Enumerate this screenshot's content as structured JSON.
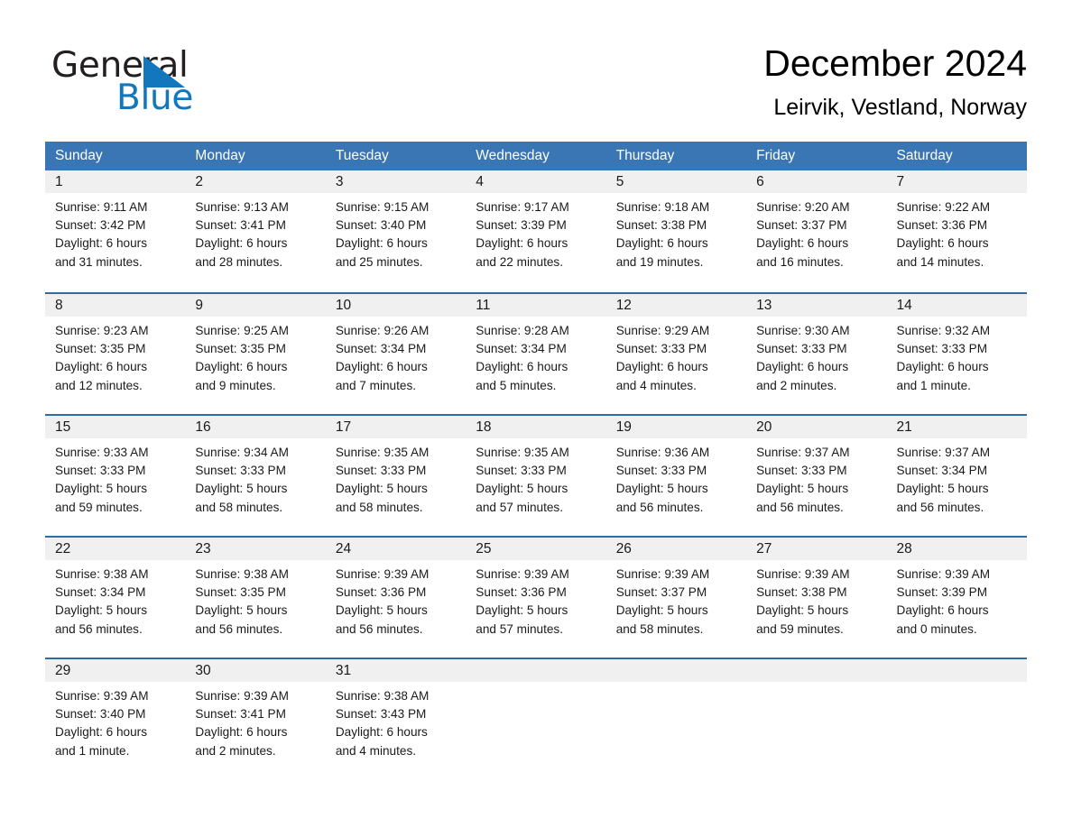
{
  "brand": {
    "name_part1": "General",
    "name_part2": "Blue",
    "triangle_color": "#1277bc",
    "text_color": "#231f20"
  },
  "header": {
    "month_title": "December 2024",
    "location": "Leirvik, Vestland, Norway"
  },
  "calendar": {
    "header_bg": "#3a76b4",
    "row_divider": "#2e6da4",
    "date_band_bg": "#f0f0f0",
    "weekdays": [
      "Sunday",
      "Monday",
      "Tuesday",
      "Wednesday",
      "Thursday",
      "Friday",
      "Saturday"
    ],
    "weeks": [
      [
        {
          "day": "1",
          "sunrise": "Sunrise: 9:11 AM",
          "sunset": "Sunset: 3:42 PM",
          "daylight_line1": "Daylight: 6 hours",
          "daylight_line2": "and 31 minutes."
        },
        {
          "day": "2",
          "sunrise": "Sunrise: 9:13 AM",
          "sunset": "Sunset: 3:41 PM",
          "daylight_line1": "Daylight: 6 hours",
          "daylight_line2": "and 28 minutes."
        },
        {
          "day": "3",
          "sunrise": "Sunrise: 9:15 AM",
          "sunset": "Sunset: 3:40 PM",
          "daylight_line1": "Daylight: 6 hours",
          "daylight_line2": "and 25 minutes."
        },
        {
          "day": "4",
          "sunrise": "Sunrise: 9:17 AM",
          "sunset": "Sunset: 3:39 PM",
          "daylight_line1": "Daylight: 6 hours",
          "daylight_line2": "and 22 minutes."
        },
        {
          "day": "5",
          "sunrise": "Sunrise: 9:18 AM",
          "sunset": "Sunset: 3:38 PM",
          "daylight_line1": "Daylight: 6 hours",
          "daylight_line2": "and 19 minutes."
        },
        {
          "day": "6",
          "sunrise": "Sunrise: 9:20 AM",
          "sunset": "Sunset: 3:37 PM",
          "daylight_line1": "Daylight: 6 hours",
          "daylight_line2": "and 16 minutes."
        },
        {
          "day": "7",
          "sunrise": "Sunrise: 9:22 AM",
          "sunset": "Sunset: 3:36 PM",
          "daylight_line1": "Daylight: 6 hours",
          "daylight_line2": "and 14 minutes."
        }
      ],
      [
        {
          "day": "8",
          "sunrise": "Sunrise: 9:23 AM",
          "sunset": "Sunset: 3:35 PM",
          "daylight_line1": "Daylight: 6 hours",
          "daylight_line2": "and 12 minutes."
        },
        {
          "day": "9",
          "sunrise": "Sunrise: 9:25 AM",
          "sunset": "Sunset: 3:35 PM",
          "daylight_line1": "Daylight: 6 hours",
          "daylight_line2": "and 9 minutes."
        },
        {
          "day": "10",
          "sunrise": "Sunrise: 9:26 AM",
          "sunset": "Sunset: 3:34 PM",
          "daylight_line1": "Daylight: 6 hours",
          "daylight_line2": "and 7 minutes."
        },
        {
          "day": "11",
          "sunrise": "Sunrise: 9:28 AM",
          "sunset": "Sunset: 3:34 PM",
          "daylight_line1": "Daylight: 6 hours",
          "daylight_line2": "and 5 minutes."
        },
        {
          "day": "12",
          "sunrise": "Sunrise: 9:29 AM",
          "sunset": "Sunset: 3:33 PM",
          "daylight_line1": "Daylight: 6 hours",
          "daylight_line2": "and 4 minutes."
        },
        {
          "day": "13",
          "sunrise": "Sunrise: 9:30 AM",
          "sunset": "Sunset: 3:33 PM",
          "daylight_line1": "Daylight: 6 hours",
          "daylight_line2": "and 2 minutes."
        },
        {
          "day": "14",
          "sunrise": "Sunrise: 9:32 AM",
          "sunset": "Sunset: 3:33 PM",
          "daylight_line1": "Daylight: 6 hours",
          "daylight_line2": "and 1 minute."
        }
      ],
      [
        {
          "day": "15",
          "sunrise": "Sunrise: 9:33 AM",
          "sunset": "Sunset: 3:33 PM",
          "daylight_line1": "Daylight: 5 hours",
          "daylight_line2": "and 59 minutes."
        },
        {
          "day": "16",
          "sunrise": "Sunrise: 9:34 AM",
          "sunset": "Sunset: 3:33 PM",
          "daylight_line1": "Daylight: 5 hours",
          "daylight_line2": "and 58 minutes."
        },
        {
          "day": "17",
          "sunrise": "Sunrise: 9:35 AM",
          "sunset": "Sunset: 3:33 PM",
          "daylight_line1": "Daylight: 5 hours",
          "daylight_line2": "and 58 minutes."
        },
        {
          "day": "18",
          "sunrise": "Sunrise: 9:35 AM",
          "sunset": "Sunset: 3:33 PM",
          "daylight_line1": "Daylight: 5 hours",
          "daylight_line2": "and 57 minutes."
        },
        {
          "day": "19",
          "sunrise": "Sunrise: 9:36 AM",
          "sunset": "Sunset: 3:33 PM",
          "daylight_line1": "Daylight: 5 hours",
          "daylight_line2": "and 56 minutes."
        },
        {
          "day": "20",
          "sunrise": "Sunrise: 9:37 AM",
          "sunset": "Sunset: 3:33 PM",
          "daylight_line1": "Daylight: 5 hours",
          "daylight_line2": "and 56 minutes."
        },
        {
          "day": "21",
          "sunrise": "Sunrise: 9:37 AM",
          "sunset": "Sunset: 3:34 PM",
          "daylight_line1": "Daylight: 5 hours",
          "daylight_line2": "and 56 minutes."
        }
      ],
      [
        {
          "day": "22",
          "sunrise": "Sunrise: 9:38 AM",
          "sunset": "Sunset: 3:34 PM",
          "daylight_line1": "Daylight: 5 hours",
          "daylight_line2": "and 56 minutes."
        },
        {
          "day": "23",
          "sunrise": "Sunrise: 9:38 AM",
          "sunset": "Sunset: 3:35 PM",
          "daylight_line1": "Daylight: 5 hours",
          "daylight_line2": "and 56 minutes."
        },
        {
          "day": "24",
          "sunrise": "Sunrise: 9:39 AM",
          "sunset": "Sunset: 3:36 PM",
          "daylight_line1": "Daylight: 5 hours",
          "daylight_line2": "and 56 minutes."
        },
        {
          "day": "25",
          "sunrise": "Sunrise: 9:39 AM",
          "sunset": "Sunset: 3:36 PM",
          "daylight_line1": "Daylight: 5 hours",
          "daylight_line2": "and 57 minutes."
        },
        {
          "day": "26",
          "sunrise": "Sunrise: 9:39 AM",
          "sunset": "Sunset: 3:37 PM",
          "daylight_line1": "Daylight: 5 hours",
          "daylight_line2": "and 58 minutes."
        },
        {
          "day": "27",
          "sunrise": "Sunrise: 9:39 AM",
          "sunset": "Sunset: 3:38 PM",
          "daylight_line1": "Daylight: 5 hours",
          "daylight_line2": "and 59 minutes."
        },
        {
          "day": "28",
          "sunrise": "Sunrise: 9:39 AM",
          "sunset": "Sunset: 3:39 PM",
          "daylight_line1": "Daylight: 6 hours",
          "daylight_line2": "and 0 minutes."
        }
      ],
      [
        {
          "day": "29",
          "sunrise": "Sunrise: 9:39 AM",
          "sunset": "Sunset: 3:40 PM",
          "daylight_line1": "Daylight: 6 hours",
          "daylight_line2": "and 1 minute."
        },
        {
          "day": "30",
          "sunrise": "Sunrise: 9:39 AM",
          "sunset": "Sunset: 3:41 PM",
          "daylight_line1": "Daylight: 6 hours",
          "daylight_line2": "and 2 minutes."
        },
        {
          "day": "31",
          "sunrise": "Sunrise: 9:38 AM",
          "sunset": "Sunset: 3:43 PM",
          "daylight_line1": "Daylight: 6 hours",
          "daylight_line2": "and 4 minutes."
        },
        {
          "day": "",
          "sunrise": "",
          "sunset": "",
          "daylight_line1": "",
          "daylight_line2": ""
        },
        {
          "day": "",
          "sunrise": "",
          "sunset": "",
          "daylight_line1": "",
          "daylight_line2": ""
        },
        {
          "day": "",
          "sunrise": "",
          "sunset": "",
          "daylight_line1": "",
          "daylight_line2": ""
        },
        {
          "day": "",
          "sunrise": "",
          "sunset": "",
          "daylight_line1": "",
          "daylight_line2": ""
        }
      ]
    ]
  }
}
